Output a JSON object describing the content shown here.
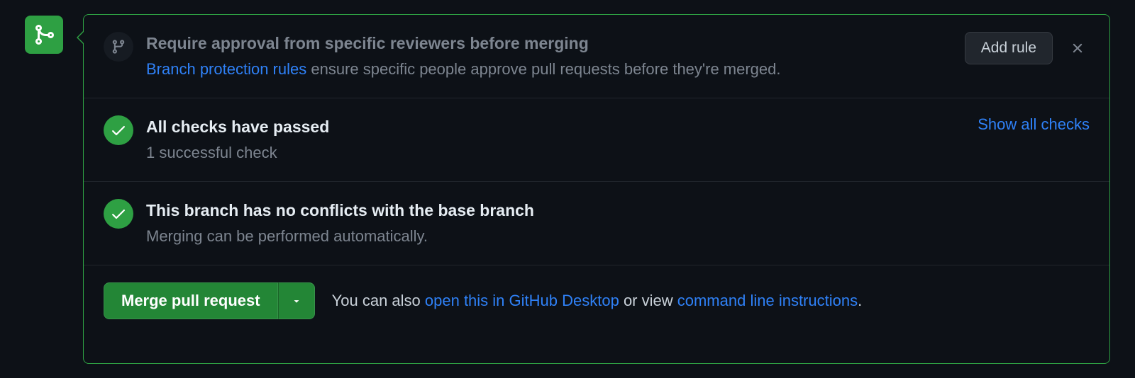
{
  "rule_suggestion": {
    "title": "Require approval from specific reviewers before merging",
    "link_text": "Branch protection rules",
    "desc_after_link": " ensure specific people approve pull requests before they're merged.",
    "add_rule_label": "Add rule"
  },
  "checks": {
    "title": "All checks have passed",
    "subtitle": "1 successful check",
    "show_all_label": "Show all checks"
  },
  "conflicts": {
    "title": "This branch has no conflicts with the base branch",
    "subtitle": "Merging can be performed automatically."
  },
  "merge": {
    "button_label": "Merge pull request",
    "footer_prefix": "You can also ",
    "desktop_link": "open this in GitHub Desktop",
    "footer_middle": " or view ",
    "cli_link": "command line instructions",
    "footer_suffix": "."
  }
}
